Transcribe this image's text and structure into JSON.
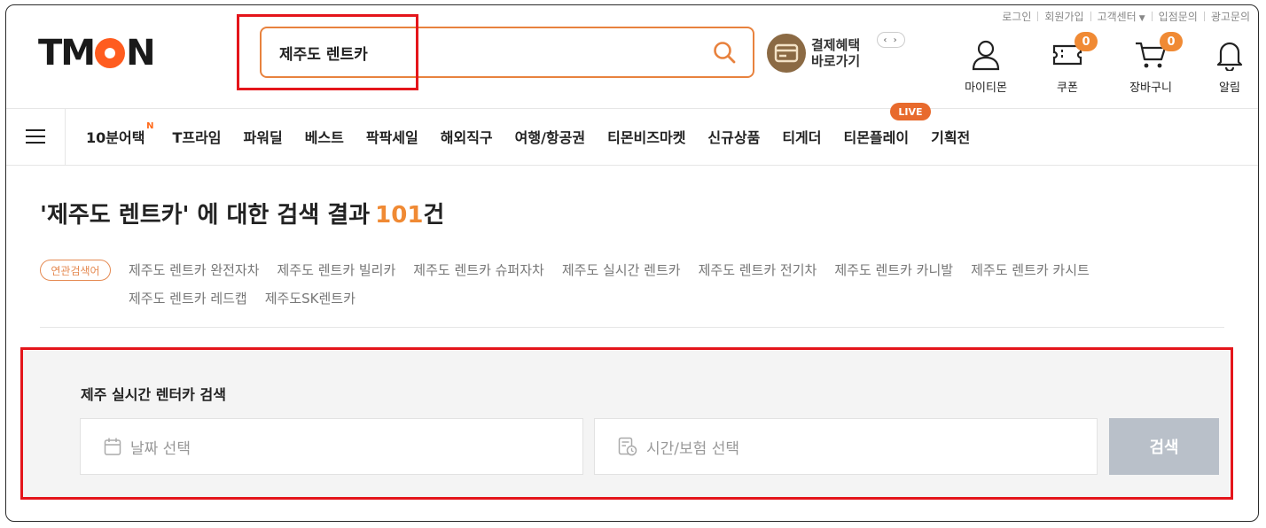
{
  "util_links": [
    "로그인",
    "회원가입",
    "고객센터",
    "입점문의",
    "광고문의"
  ],
  "logo": "TMON",
  "search": {
    "value": "제주도 렌트카"
  },
  "payment_banner": {
    "line1": "결제혜택",
    "line2": "바로가기"
  },
  "header_icons": {
    "mytmon": "마이티몬",
    "coupon": "쿠폰",
    "coupon_count": "0",
    "cart": "장바구니",
    "cart_count": "0",
    "alarm": "알림"
  },
  "nav": {
    "items": [
      "10분어택",
      "T프라임",
      "파워딜",
      "베스트",
      "팍팍세일",
      "해외직구",
      "여행/항공권",
      "티몬비즈마켓",
      "신규상품",
      "티게더",
      "티몬플레이",
      "기획전"
    ],
    "new_badge": "N",
    "live_badge": "LIVE"
  },
  "result": {
    "query_text": "'제주도 렌트카' 에 대한 검색 결과",
    "count": "101",
    "unit": "건"
  },
  "related": {
    "tag": "연관검색어",
    "items": [
      "제주도 렌트카 완전자차",
      "제주도 렌트카 빌리카",
      "제주도 렌트카 슈퍼자차",
      "제주도 실시간 렌트카",
      "제주도 렌트카 전기차",
      "제주도 렌트카 카니발",
      "제주도 렌트카 카시트",
      "제주도 렌트카 레드캡",
      "제주도SK렌트카"
    ]
  },
  "rentcar": {
    "title": "제주 실시간 렌터카 검색",
    "date_placeholder": "날짜 선택",
    "time_placeholder": "시간/보험 선택",
    "search_button": "검색"
  },
  "colors": {
    "accent": "#f08a34",
    "highlight_box": "#e4151b",
    "brand_orange": "#ff5c1f"
  }
}
